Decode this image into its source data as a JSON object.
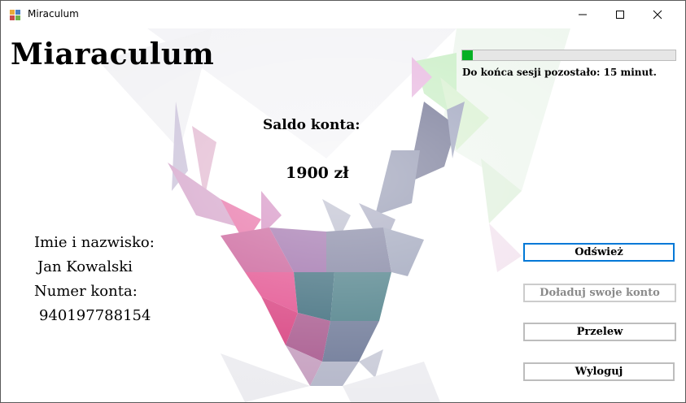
{
  "window": {
    "title": "Miraculum",
    "app_icon": "winforms-app-icon",
    "controls": {
      "minimize": "─",
      "maximize": "☐",
      "close": "✕"
    }
  },
  "header": {
    "title": "Miaraculum"
  },
  "session": {
    "progress_fraction": 0.05,
    "progress_color": "#06b025",
    "remaining_text": "Do końca sesji pozostało: 15 minut."
  },
  "account": {
    "balance_label": "Saldo konta:",
    "balance_value": "1900 zł",
    "name_label": "Imie i nazwisko:",
    "name_value": "Jan Kowalski",
    "number_label": "Numer konta:",
    "number_value": "940197788154"
  },
  "buttons": {
    "refresh": "Odśwież",
    "topup": "Doładuj swoje konto",
    "transfer": "Przelew",
    "logout": "Wyloguj"
  },
  "background": {
    "art": "low-poly-deer-head-icon"
  }
}
